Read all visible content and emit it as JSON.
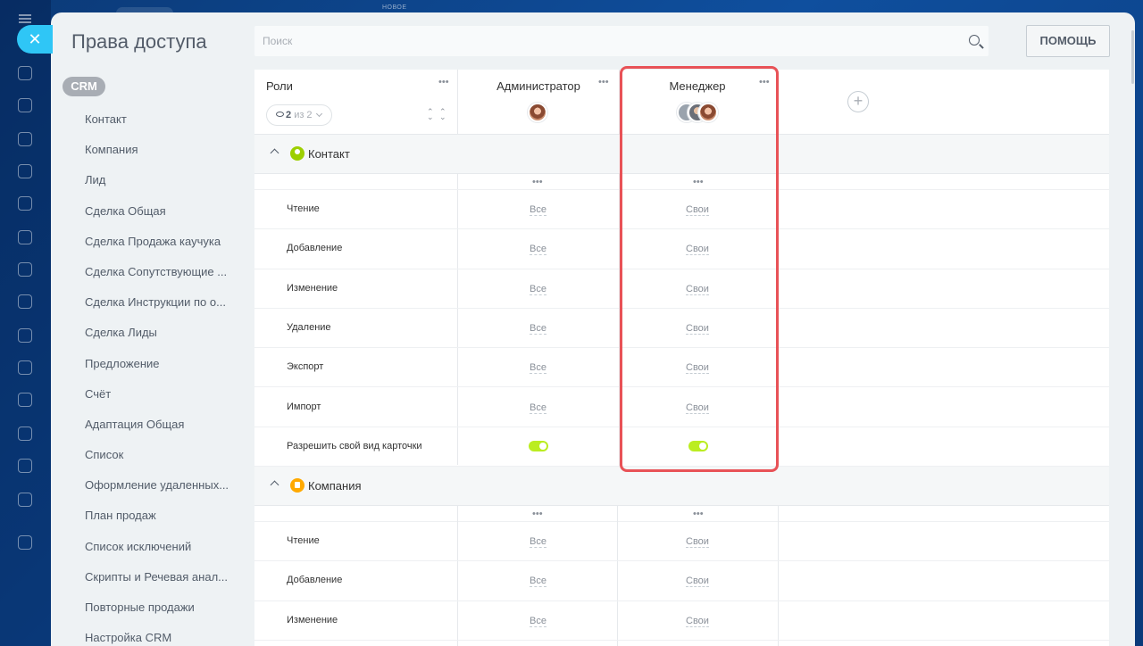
{
  "background": {
    "new_label": "НОВОЕ"
  },
  "colors": {
    "accent": "#2fc6f6",
    "highlight": "#e85257",
    "toggle_on": "#bbed21"
  },
  "header": {
    "title": "Права доступа",
    "search_placeholder": "Поиск",
    "help_label": "ПОМОЩЬ"
  },
  "sidebar": {
    "section": "CRM",
    "items": [
      "Контакт",
      "Компания",
      "Лид",
      "Сделка Общая",
      "Сделка Продажа каучука",
      "Сделка Сопутствующие ...",
      "Сделка Инструкции по о...",
      "Сделка Лиды",
      "Предложение",
      "Счёт",
      "Адаптация Общая",
      "Список",
      "Оформление удаленных...",
      "План продаж",
      "Список исключений",
      "Скрипты и Речевая анал...",
      "Повторные продажи",
      "Настройка CRM"
    ]
  },
  "table": {
    "roles_label": "Роли",
    "filter": {
      "count": "2",
      "of": "из 2"
    },
    "roles": [
      {
        "name": "Администратор"
      },
      {
        "name": "Менеджер"
      }
    ],
    "sections": [
      {
        "title": "Контакт",
        "rows": [
          {
            "label": "Чтение",
            "values": [
              "Все",
              "Свои"
            ]
          },
          {
            "label": "Добавление",
            "values": [
              "Все",
              "Свои"
            ]
          },
          {
            "label": "Изменение",
            "values": [
              "Все",
              "Свои"
            ]
          },
          {
            "label": "Удаление",
            "values": [
              "Все",
              "Свои"
            ]
          },
          {
            "label": "Экспорт",
            "values": [
              "Все",
              "Свои"
            ]
          },
          {
            "label": "Импорт",
            "values": [
              "Все",
              "Свои"
            ]
          },
          {
            "label": "Разрешить свой вид карточки",
            "toggles": [
              true,
              true
            ]
          }
        ]
      },
      {
        "title": "Компания",
        "rows": [
          {
            "label": "Чтение",
            "values": [
              "Все",
              "Свои"
            ]
          },
          {
            "label": "Добавление",
            "values": [
              "Все",
              "Свои"
            ]
          },
          {
            "label": "Изменение",
            "values": [
              "Все",
              "Свои"
            ]
          }
        ]
      }
    ]
  }
}
